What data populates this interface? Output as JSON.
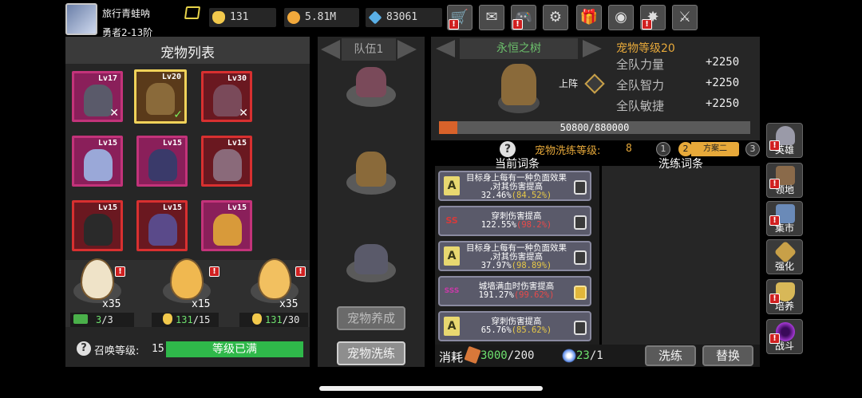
{
  "player": {
    "name": "旅行青蛙呐",
    "rank": "勇者2-13阶"
  },
  "currency": [
    {
      "name": "gold",
      "value": "131",
      "color": "#f2c94c",
      "icon": "gold-icon"
    },
    {
      "name": "coins",
      "value": "5.81M",
      "color": "#f2a93c",
      "icon": "coin-plus-icon"
    },
    {
      "name": "gems",
      "value": "83061",
      "color": "#5ab0e8",
      "icon": "gem-icon"
    }
  ],
  "top_buttons": [
    {
      "icon": "shop-cart-icon",
      "glyph": "🛒"
    },
    {
      "icon": "mail-icon",
      "glyph": "✉"
    },
    {
      "icon": "gamepad-icon",
      "glyph": "🎮"
    },
    {
      "icon": "settings-gear-icon",
      "glyph": "⚙"
    },
    {
      "icon": "gift-icon",
      "glyph": "🎁"
    },
    {
      "icon": "color-wheel-icon",
      "glyph": "◉"
    },
    {
      "icon": "firework-icon",
      "glyph": "✸"
    },
    {
      "icon": "sword-icon",
      "glyph": "⚔"
    }
  ],
  "pet_list": {
    "title": "宠物列表",
    "pets": [
      {
        "level": "Lv17",
        "mark": "✕",
        "color": "#5a5a6a"
      },
      {
        "level": "Lv20",
        "mark": "✓",
        "color": "#8a6a3a"
      },
      {
        "level": "Lv30",
        "mark": "✕",
        "color": "#7a4a5a"
      },
      {
        "level": "Lv15",
        "mark": "",
        "color": "#9aa8d8"
      },
      {
        "level": "Lv15",
        "mark": "",
        "color": "#3a3a6a"
      },
      {
        "level": "Lv15",
        "mark": "",
        "color": "#8a6a7a"
      },
      {
        "level": "Lv15",
        "mark": "",
        "color": "#2a2a2a"
      },
      {
        "level": "Lv15",
        "mark": "",
        "color": "#5a4a8a"
      },
      {
        "level": "Lv15",
        "mark": "",
        "color": "#d89a3a"
      }
    ]
  },
  "eggs": [
    {
      "count": "x35",
      "color": "#efe3c8",
      "req_have": "3",
      "req_need": "/3",
      "req_icon": "video-ad-icon"
    },
    {
      "count": "x15",
      "color": "#f0b850",
      "req_have": "131",
      "req_need": "/15",
      "req_icon": "gold-icon"
    },
    {
      "count": "x35",
      "color": "#f2c060",
      "req_have": "131",
      "req_need": "/30",
      "req_icon": "gold-icon"
    }
  ],
  "summon": {
    "label": "召唤等级:",
    "level": "15",
    "status": "等级已满"
  },
  "team": {
    "label": "队伍1",
    "raise_button": "宠物养成",
    "reroll_button": "宠物洗练"
  },
  "detail": {
    "pet_name": "永恒之树",
    "deploy_label": "上阵",
    "pet_level": "宠物等级20",
    "stats": [
      {
        "name": "全队力量",
        "value": "+2250"
      },
      {
        "name": "全队智力",
        "value": "+2250"
      },
      {
        "name": "全队敏捷",
        "value": "+2250"
      }
    ],
    "exp": "50800/880000",
    "exp_fraction": 0.058
  },
  "reroll": {
    "level_label": "宠物洗练等级:",
    "level": "8",
    "plans": [
      "1",
      "2",
      "方案二",
      "3"
    ],
    "current_header": "当前词条",
    "reroll_header": "洗练词条",
    "affixes": [
      {
        "badge": "A",
        "badge_color": "#e8d870",
        "line1": "目标身上每有一种负面效果",
        "line2": ",对其伤害提高",
        "value": "32.46%",
        "max": "(84.52%)",
        "locked": false
      },
      {
        "badge": "SS",
        "badge_color": "#d83a3a",
        "line1": "穿刺伤害提高",
        "line2": "",
        "value": "122.55%",
        "max": "(98.2%)",
        "locked": false
      },
      {
        "badge": "A",
        "badge_color": "#e8d870",
        "line1": "目标身上每有一种负面效果",
        "line2": ",对其伤害提高",
        "value": "37.97%",
        "max": "(98.89%)",
        "locked": false
      },
      {
        "badge": "SSS",
        "badge_color": "#c83aa8",
        "line1": "城墙满血时伤害提高",
        "line2": "",
        "value": "191.27%",
        "max": "(99.62%)",
        "locked": true
      },
      {
        "badge": "A",
        "badge_color": "#e8d870",
        "line1": "穿刺伤害提高",
        "line2": "",
        "value": "65.76%",
        "max": "(85.62%)",
        "locked": false
      }
    ],
    "cost_label": "消耗",
    "cost1_have": "3000",
    "cost1_need": "/200",
    "cost2_have": "23",
    "cost2_need": "/1",
    "reroll_button": "洗练",
    "replace_button": "替换"
  },
  "side_menu": [
    {
      "label": "英雄",
      "icon": "hero-helmet-icon",
      "color": "#9a9aa8"
    },
    {
      "label": "领地",
      "icon": "castle-icon",
      "color": "#8a6a4a"
    },
    {
      "label": "集市",
      "icon": "market-stall-icon",
      "color": "#6a8ab8"
    },
    {
      "label": "强化",
      "icon": "crystal-icon",
      "color": "#c8a048"
    },
    {
      "label": "培养",
      "icon": "trophy-icon",
      "color": "#d8b858"
    },
    {
      "label": "战斗",
      "icon": "portal-icon",
      "color": "#a83ad8"
    }
  ]
}
